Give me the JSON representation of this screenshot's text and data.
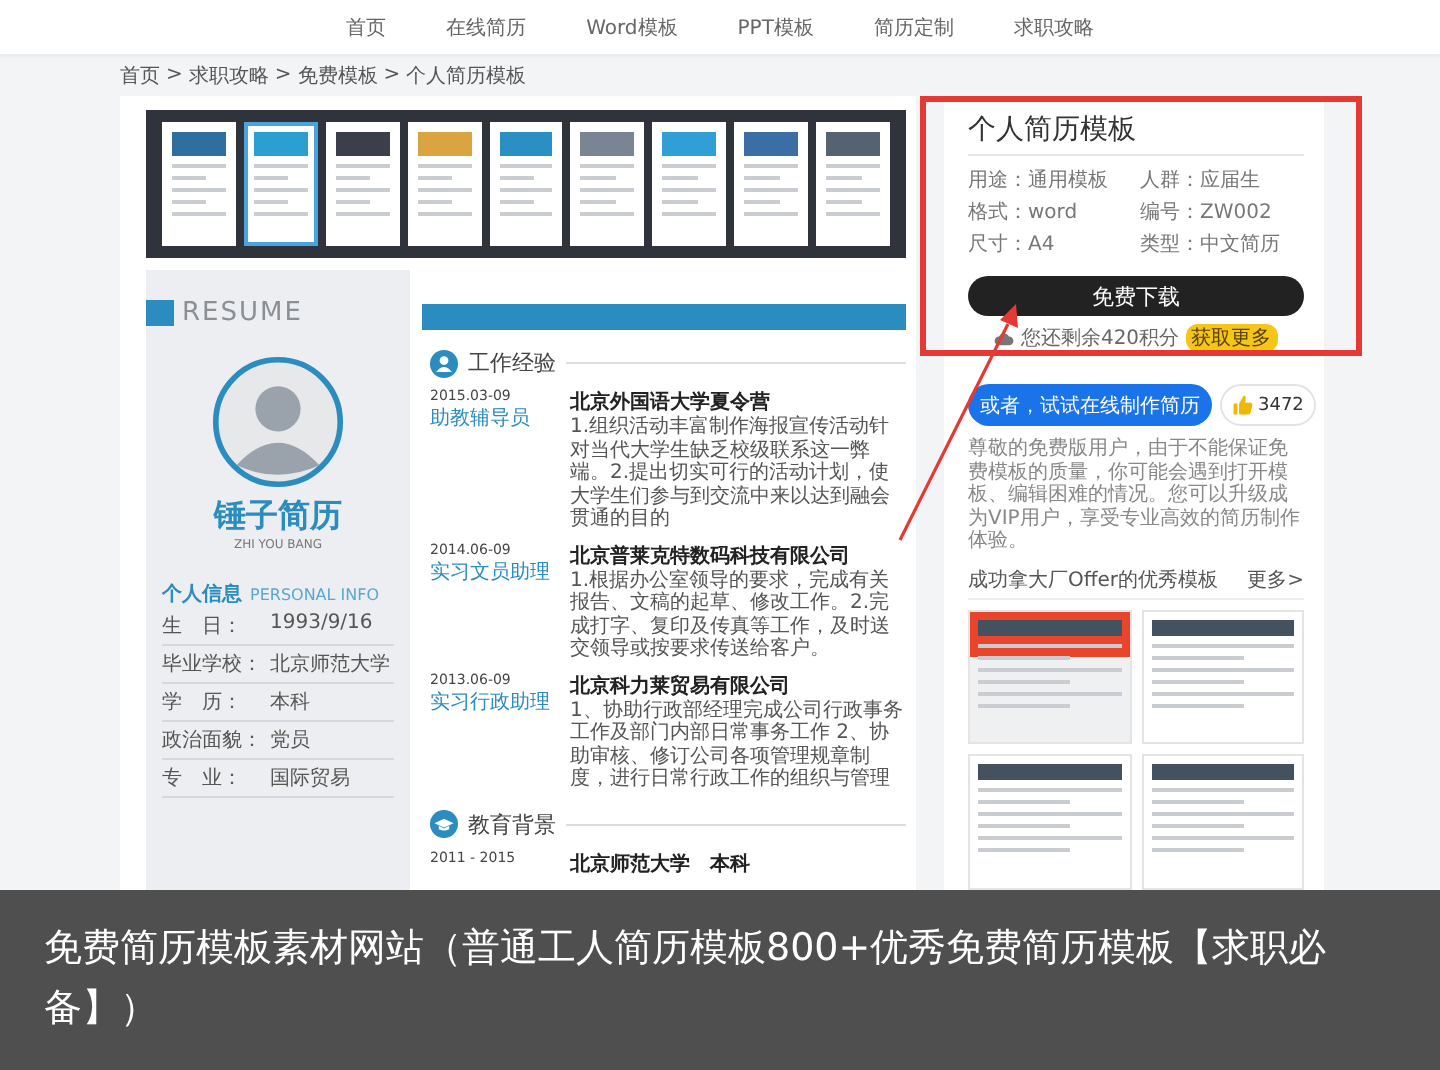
{
  "nav": {
    "items": [
      {
        "label": "首页",
        "selected": false
      },
      {
        "label": "在线简历",
        "selected": false
      },
      {
        "label": "Word模板",
        "selected": false
      },
      {
        "label": "PPT模板",
        "selected": false
      },
      {
        "label": "简历定制",
        "selected": false
      },
      {
        "label": "求职攻略",
        "selected": false
      }
    ]
  },
  "breadcrumb": {
    "separator": ">",
    "items": [
      "首页",
      "求职攻略",
      "免费模板",
      "个人简历模板"
    ]
  },
  "thumbnails": [
    {
      "color": "#2e6f9e",
      "selected": false
    },
    {
      "color": "#2a9fd0",
      "selected": true
    },
    {
      "color": "#3a3f4a",
      "selected": false
    },
    {
      "color": "#d9a441",
      "selected": false
    },
    {
      "color": "#2a8fc2",
      "selected": false
    },
    {
      "color": "#7a8594",
      "selected": false
    },
    {
      "color": "#2f9fd6",
      "selected": false
    },
    {
      "color": "#3a6ea5",
      "selected": false
    },
    {
      "color": "#556270",
      "selected": false
    }
  ],
  "resume": {
    "banner": "RESUME",
    "name": "锤子简历",
    "name_en": "ZHI YOU BANG",
    "info_title": "个人信息",
    "info_title_en": "PERSONAL INFO",
    "info": [
      {
        "label": "生　日：",
        "value": "1993/9/16"
      },
      {
        "label": "毕业学校：",
        "value": "北京师范大学"
      },
      {
        "label": "学　历：",
        "value": "本科"
      },
      {
        "label": "政治面貌：",
        "value": "党员"
      },
      {
        "label": "专　业：",
        "value": "国际贸易"
      }
    ],
    "work": {
      "title": "工作经验",
      "entries": [
        {
          "date": "2015.03-09",
          "role": "助教辅导员",
          "company": "北京外国语大学夏令营",
          "desc": "1.组织活动丰富制作海报宣传活动针对当代大学生缺乏校级联系这一弊端。2.提出切实可行的活动计划，使大学生们参与到交流中来以达到融会贯通的目的"
        },
        {
          "date": "2014.06-09",
          "role": "实习文员助理",
          "company": "北京普莱克特数码科技有限公司",
          "desc": "1.根据办公室领导的要求，完成有关报告、文稿的起草、修改工作。2.完成打字、复印及传真等工作，及时送交领导或按要求传送给客户。"
        },
        {
          "date": "2013.06-09",
          "role": "实习行政助理",
          "company": "北京科力莱贸易有限公司",
          "desc": "1、协助行政部经理完成公司行政事务工作及部门内部日常事务工作 2、协助审核、修订公司各项管理规章制度，进行日常行政工作的组织与管理"
        }
      ]
    },
    "education": {
      "title": "教育背景",
      "entries": [
        {
          "date": "2011 - 2015",
          "school": "北京师范大学　本科"
        }
      ]
    }
  },
  "detail": {
    "title": "个人简历模板",
    "meta": [
      "用途：通用模板",
      "人群：应届生",
      "格式：word",
      "编号：ZW002",
      "尺寸：A4",
      "类型：中文简历"
    ],
    "download": "免费下载",
    "points": "您还剩余420积分",
    "more_points": "获取更多",
    "online": "或者，试试在线制作简历",
    "likes": "3472",
    "notice": "尊敬的免费版用户，由于不能保证免费模板的质量，你可能会遇到打开模板、编辑困难的情况。您可以升级成为VIP用户，享受专业高效的简历制作体验。",
    "recommend_title": "成功拿大厂Offer的优秀模板",
    "recommend_more": "更多>",
    "templates": [
      {
        "kind": "promo"
      },
      {
        "kind": "plain"
      },
      {
        "kind": "plain"
      },
      {
        "kind": "plain"
      }
    ]
  },
  "caption": "免费简历模板素材网站（普通工人简历模板800+优秀免费简历模板【求职必备】）"
}
